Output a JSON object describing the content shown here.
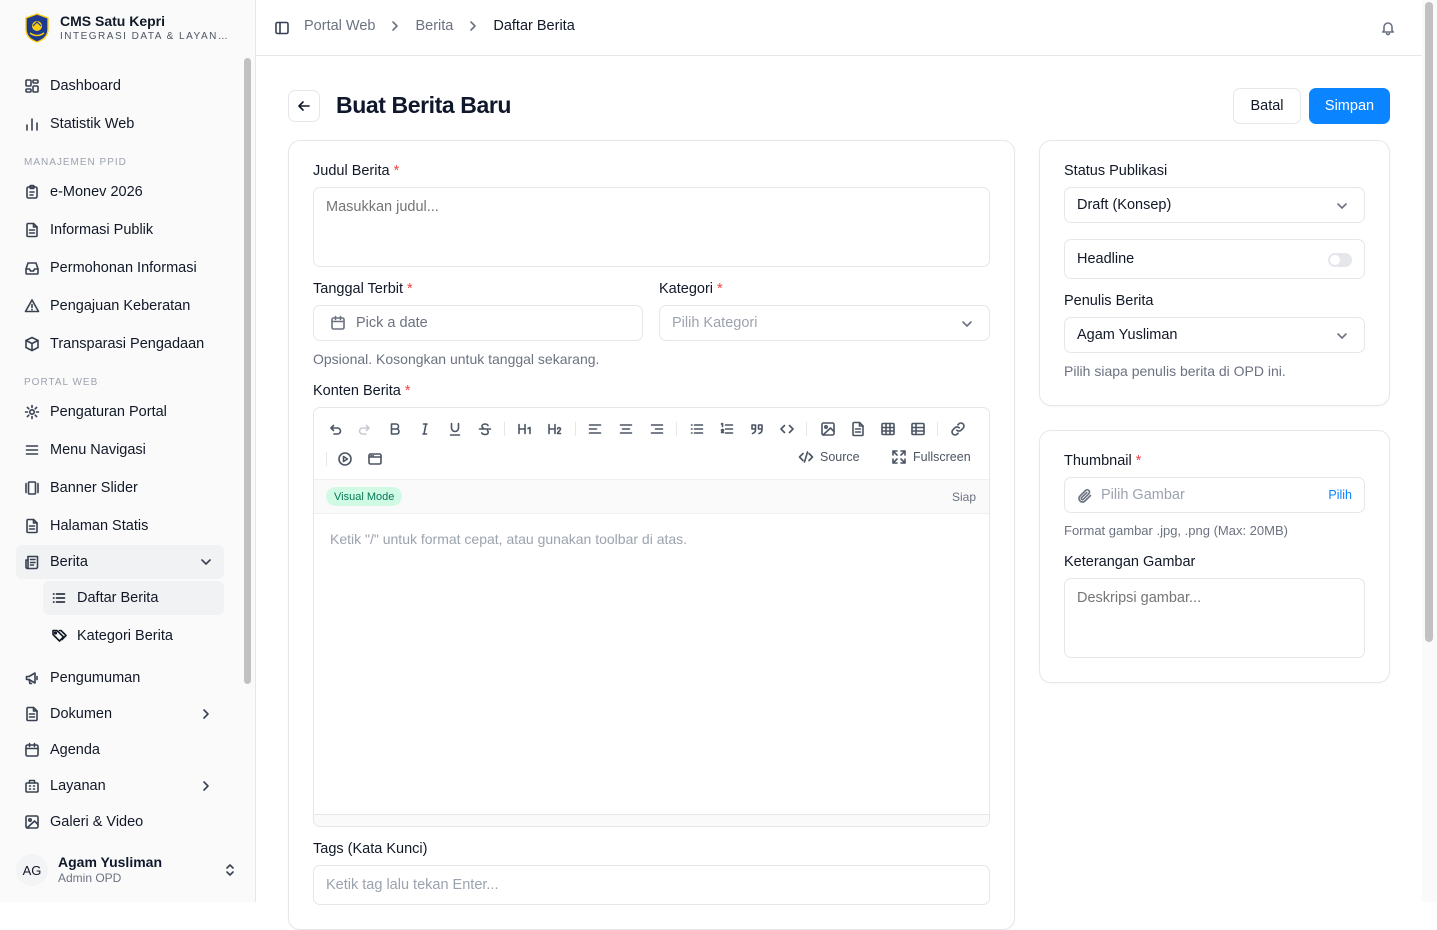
{
  "brand": {
    "name": "CMS Satu Kepri",
    "subtitle": "INTEGRASI DATA & LAYANAN"
  },
  "sidebar": {
    "top_items": [
      {
        "label": "Dashboard",
        "icon": "layout-dashboard-icon"
      },
      {
        "label": "Statistik Web",
        "icon": "bar-chart-icon"
      }
    ],
    "groups": [
      {
        "title": "MANAJEMEN PPID",
        "items": [
          {
            "label": "e-Monev 2026",
            "icon": "clipboard-icon"
          },
          {
            "label": "Informasi Publik",
            "icon": "file-text-icon"
          },
          {
            "label": "Permohonan Informasi",
            "icon": "inbox-icon"
          },
          {
            "label": "Pengajuan Keberatan",
            "icon": "alert-triangle-icon"
          },
          {
            "label": "Transparasi Pengadaan",
            "icon": "package-icon"
          }
        ]
      },
      {
        "title": "PORTAL WEB",
        "items": [
          {
            "label": "Pengaturan Portal",
            "icon": "settings-icon"
          },
          {
            "label": "Menu Navigasi",
            "icon": "menu-icon"
          },
          {
            "label": "Banner Slider",
            "icon": "gallery-icon"
          },
          {
            "label": "Halaman Statis",
            "icon": "file-icon"
          },
          {
            "label": "Berita",
            "icon": "newspaper-icon"
          }
        ]
      }
    ],
    "berita_sub": [
      {
        "label": "Daftar Berita",
        "icon": "list-icon",
        "active": true
      },
      {
        "label": "Kategori Berita",
        "icon": "tags-icon",
        "active": false
      }
    ],
    "bottom_items": [
      {
        "label": "Pengumuman",
        "icon": "megaphone-icon"
      },
      {
        "label": "Dokumen",
        "icon": "file-icon"
      },
      {
        "label": "Agenda",
        "icon": "calendar-icon"
      },
      {
        "label": "Layanan",
        "icon": "building-icon"
      },
      {
        "label": "Galeri & Video",
        "icon": "image-icon"
      }
    ],
    "user": {
      "initials": "AG",
      "name": "Agam Yusliman",
      "role": "Admin OPD"
    }
  },
  "breadcrumb": [
    "Portal Web",
    "Berita",
    "Daftar Berita"
  ],
  "page": {
    "title": "Buat Berita Baru",
    "cancel_label": "Batal",
    "save_label": "Simpan"
  },
  "form": {
    "title_label": "Judul Berita",
    "title_placeholder": "Masukkan judul...",
    "date_label": "Tanggal Terbit",
    "date_placeholder": "Pick a date",
    "date_hint": "Opsional. Kosongkan untuk tanggal sekarang.",
    "category_label": "Kategori",
    "category_placeholder": "Pilih Kategori",
    "content_label": "Konten Berita",
    "required_mark": "*",
    "editor": {
      "source_label": "Source",
      "fullscreen_label": "Fullscreen",
      "mode_label": "Visual Mode",
      "status": "Siap",
      "placeholder": "Ketik \"/\" untuk format cepat, atau gunakan toolbar di atas."
    },
    "tags_label": "Tags (Kata Kunci)",
    "tags_placeholder": "Ketik tag lalu tekan Enter..."
  },
  "side": {
    "status_label": "Status Publikasi",
    "status_value": "Draft (Konsep)",
    "headline_label": "Headline",
    "headline_on": false,
    "writer_label": "Penulis Berita",
    "writer_value": "Agam Yusliman",
    "writer_hint": "Pilih siapa penulis berita di OPD ini.",
    "thumbnail_label": "Thumbnail",
    "thumbnail_placeholder": "Pilih Gambar",
    "thumbnail_pick": "Pilih",
    "thumbnail_hint": "Format gambar .jpg, .png (Max: 20MB)",
    "caption_label": "Keterangan Gambar",
    "caption_placeholder": "Deskripsi gambar..."
  },
  "colors": {
    "accent": "#0a84ff",
    "required": "#ef4444",
    "mode_pill_bg": "#d1fae5",
    "mode_pill_text": "#047857"
  }
}
